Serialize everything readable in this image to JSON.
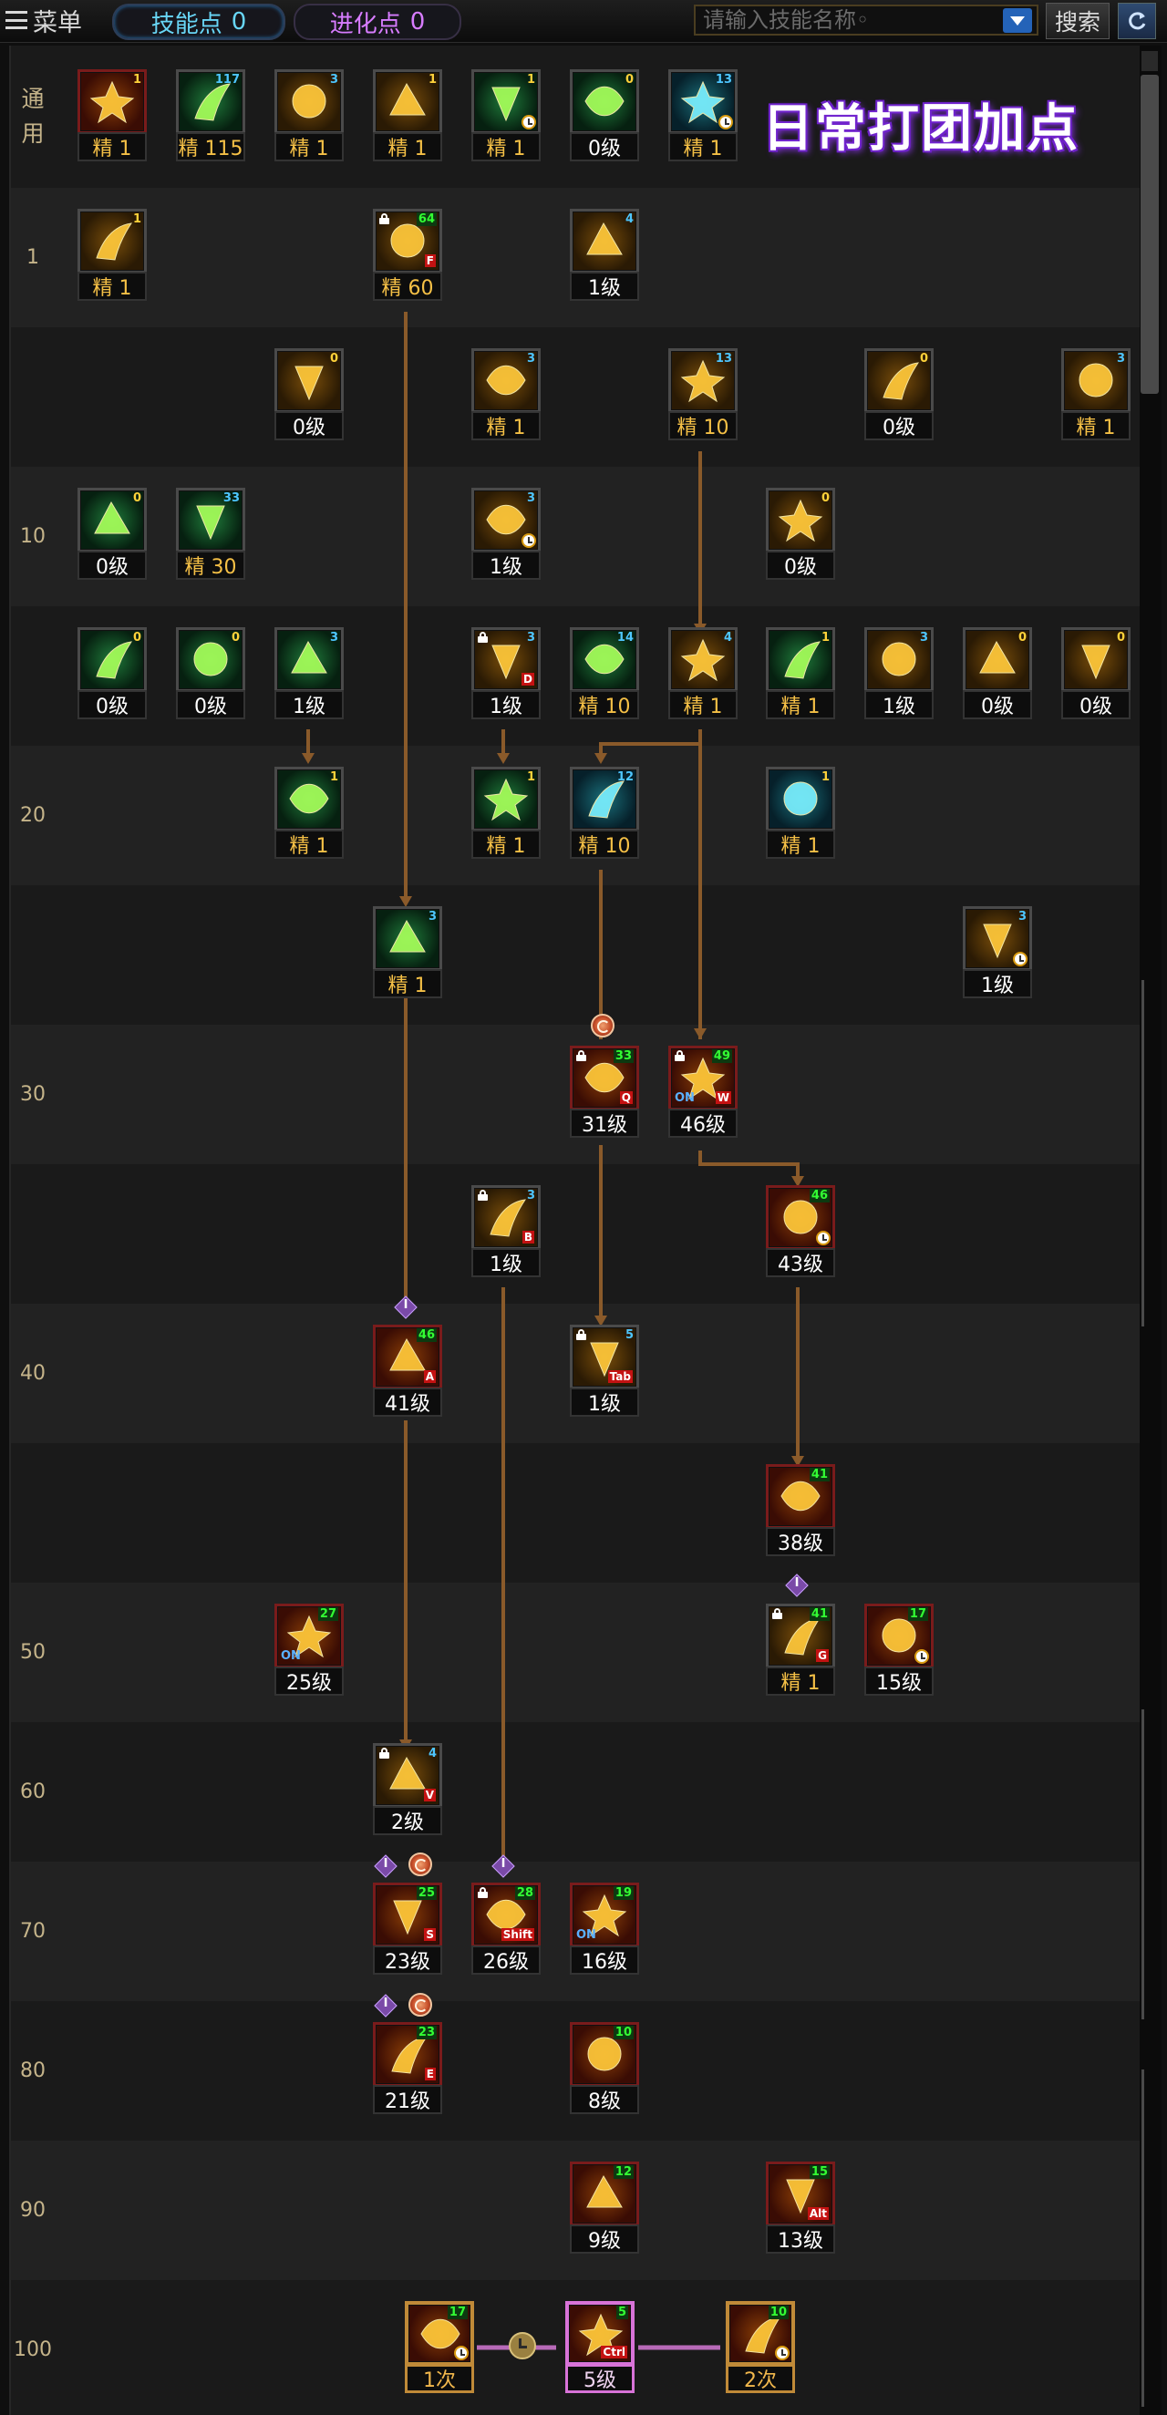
{
  "topbar": {
    "menu_label": "菜单",
    "skill_points_label": "技能点",
    "skill_points_value": "0",
    "evolution_points_label": "进化点",
    "evolution_points_value": "0",
    "search_placeholder": "请输入技能名称◦",
    "search_button": "搜索"
  },
  "overlay_title": "日常打团加点",
  "levels": {
    "common": [
      "通",
      "用"
    ],
    "rows": [
      "1",
      "10",
      "20",
      "30",
      "40",
      "50",
      "60",
      "70",
      "80",
      "90",
      "100"
    ]
  },
  "colors": {
    "line": "#8a5a2a",
    "chain": "#b86ab8",
    "skill_points_text": "#68d6f6",
    "evolution_points_text": "#d77cff",
    "jing_text": "#f5c046"
  },
  "skills": [
    {
      "id": "s1",
      "level": "精 1",
      "badge": "1",
      "badge_color": "yellow",
      "icon": "fire-blast-icon",
      "style": "red"
    },
    {
      "id": "s2",
      "level": "精 115",
      "badge": "117",
      "badge_color": "blue",
      "icon": "dragon-head-icon",
      "style": "green"
    },
    {
      "id": "s3",
      "level": "精 1",
      "badge": "3",
      "badge_color": "blue",
      "icon": "flame-dash-icon",
      "style": ""
    },
    {
      "id": "s4",
      "level": "精 1",
      "badge": "1",
      "badge_color": "yellow",
      "icon": "sitting-figure-icon",
      "style": ""
    },
    {
      "id": "s5",
      "level": "精 1",
      "badge": "1",
      "badge_color": "yellow",
      "icon": "running-figure-icon",
      "style": "green",
      "clock": true
    },
    {
      "id": "s6",
      "level": "0级",
      "badge": "0",
      "badge_color": "yellow",
      "icon": "target-icon",
      "style": "green"
    },
    {
      "id": "s7",
      "level": "精 1",
      "badge": "13",
      "badge_color": "blue",
      "icon": "wings-icon",
      "style": "teal",
      "clock": true
    },
    {
      "id": "s8",
      "level": "精 1",
      "badge": "1",
      "badge_color": "yellow",
      "icon": "fist-icon",
      "style": ""
    },
    {
      "id": "s9",
      "level": "精 60",
      "badge": "64",
      "badge_color": "green",
      "icon": "claw-slash-icon",
      "style": "",
      "lock": true,
      "hotkey": "F"
    },
    {
      "id": "s10",
      "level": "1级",
      "badge": "4",
      "badge_color": "blue",
      "icon": "claw-swipe-icon",
      "style": ""
    },
    {
      "id": "s11",
      "level": "0级",
      "badge": "0",
      "badge_color": "yellow",
      "icon": "feather-icon",
      "style": ""
    },
    {
      "id": "s12",
      "level": "精 1",
      "badge": "3",
      "badge_color": "blue",
      "icon": "arrow-burst-icon",
      "style": ""
    },
    {
      "id": "s13",
      "level": "精 10",
      "badge": "13",
      "badge_color": "blue",
      "icon": "crescent-icon",
      "style": ""
    },
    {
      "id": "s14",
      "level": "0级",
      "badge": "0",
      "badge_color": "yellow",
      "icon": "shield-icon",
      "style": ""
    },
    {
      "id": "s15",
      "level": "精 1",
      "badge": "3",
      "badge_color": "blue",
      "icon": "triple-claw-icon",
      "style": ""
    },
    {
      "id": "s16",
      "level": "0级",
      "badge": "0",
      "badge_color": "yellow",
      "icon": "green-spear-icon",
      "style": "green"
    },
    {
      "id": "s17",
      "level": "精 30",
      "badge": "33",
      "badge_color": "blue",
      "icon": "green-blade-icon",
      "style": "green"
    },
    {
      "id": "s18",
      "level": "1级",
      "badge": "3",
      "badge_color": "blue",
      "icon": "dash-figure-icon",
      "style": "",
      "clock": true
    },
    {
      "id": "s19",
      "level": "0级",
      "badge": "0",
      "badge_color": "yellow",
      "icon": "vortex-icon",
      "style": ""
    },
    {
      "id": "s20",
      "level": "0级",
      "badge": "0",
      "badge_color": "yellow",
      "icon": "green-slab-icon",
      "style": "green"
    },
    {
      "id": "s21",
      "level": "0级",
      "badge": "0",
      "badge_color": "yellow",
      "icon": "green-burst-icon",
      "style": "green"
    },
    {
      "id": "s22",
      "level": "1级",
      "badge": "3",
      "badge_color": "blue",
      "icon": "chain-icon",
      "style": "green"
    },
    {
      "id": "s23",
      "level": "1级",
      "badge": "3",
      "badge_color": "blue",
      "icon": "moon-slash-icon",
      "style": "",
      "lock": true,
      "hotkey": "D"
    },
    {
      "id": "s24",
      "level": "精 10",
      "badge": "14",
      "badge_color": "blue",
      "icon": "green-shield-icon",
      "style": "green"
    },
    {
      "id": "s25",
      "level": "精 1",
      "badge": "4",
      "badge_color": "blue",
      "icon": "sun-wheel-icon",
      "style": ""
    },
    {
      "id": "s26",
      "level": "精 1",
      "badge": "1",
      "badge_color": "yellow",
      "icon": "green-crescent-icon",
      "style": "green"
    },
    {
      "id": "s27",
      "level": "1级",
      "badge": "3",
      "badge_color": "blue",
      "icon": "twin-slash-icon",
      "style": ""
    },
    {
      "id": "s28",
      "level": "0级",
      "badge": "0",
      "badge_color": "yellow",
      "icon": "cross-sword-icon",
      "style": ""
    },
    {
      "id": "s29",
      "level": "0级",
      "badge": "0",
      "badge_color": "yellow",
      "icon": "spark-icon",
      "style": ""
    },
    {
      "id": "s30",
      "level": "精 1",
      "badge": "1",
      "badge_color": "yellow",
      "icon": "green-figure-icon",
      "style": "green"
    },
    {
      "id": "s31",
      "level": "精 1",
      "badge": "1",
      "badge_color": "yellow",
      "icon": "green-orb-icon",
      "style": "green"
    },
    {
      "id": "s32",
      "level": "精 10",
      "badge": "12",
      "badge_color": "blue",
      "icon": "pyramid-icon",
      "style": "teal"
    },
    {
      "id": "s33",
      "level": "精 1",
      "badge": "1",
      "badge_color": "yellow",
      "icon": "blue-spirit-icon",
      "style": "teal"
    },
    {
      "id": "s34",
      "level": "精 1",
      "badge": "3",
      "badge_color": "blue",
      "icon": "tornado-icon",
      "style": "green"
    },
    {
      "id": "s35",
      "level": "1级",
      "badge": "3",
      "badge_color": "blue",
      "icon": "fan-wind-icon",
      "style": "",
      "clock": true
    },
    {
      "id": "s36",
      "level": "31级",
      "badge": "33",
      "badge_color": "green",
      "icon": "flaming-slash-icon",
      "style": "red",
      "lock": true,
      "hotkey": "Q"
    },
    {
      "id": "s37",
      "level": "46级",
      "badge": "49",
      "badge_color": "green",
      "icon": "dragon-roar-icon",
      "style": "red",
      "lock": true,
      "hotkey": "W",
      "on": true
    },
    {
      "id": "s38",
      "level": "1级",
      "badge": "3",
      "badge_color": "blue",
      "icon": "pillar-icon",
      "style": "",
      "lock": true,
      "hotkey": "B"
    },
    {
      "id": "s39",
      "level": "43级",
      "badge": "46",
      "badge_color": "green",
      "icon": "fire-dragon-icon",
      "style": "red",
      "clock": true
    },
    {
      "id": "s40",
      "level": "41级",
      "badge": "46",
      "badge_color": "green",
      "icon": "fire-pierce-icon",
      "style": "red",
      "hotkey": "A"
    },
    {
      "id": "s41",
      "level": "1级",
      "badge": "5",
      "badge_color": "blue",
      "icon": "lance-icon",
      "style": "",
      "lock": true,
      "hotkey": "Tab"
    },
    {
      "id": "s42",
      "level": "38级",
      "badge": "41",
      "badge_color": "green",
      "icon": "fire-beast-icon",
      "style": "red"
    },
    {
      "id": "s43",
      "level": "25级",
      "badge": "27",
      "badge_color": "green",
      "icon": "green-aura-icon",
      "style": "red",
      "on": true
    },
    {
      "id": "s44",
      "level": "精 1",
      "badge": "41",
      "badge_color": "green",
      "icon": "golden-beast-icon",
      "style": "",
      "lock": true,
      "hotkey": "G"
    },
    {
      "id": "s45",
      "level": "15级",
      "badge": "17",
      "badge_color": "green",
      "icon": "fire-wolf-icon",
      "style": "red",
      "clock": true
    },
    {
      "id": "s46",
      "level": "2级",
      "badge": "4",
      "badge_color": "blue",
      "icon": "flame-pillar-icon",
      "style": "",
      "lock": true,
      "hotkey": "V"
    },
    {
      "id": "s47",
      "level": "23级",
      "badge": "25",
      "badge_color": "green",
      "icon": "fire-spiral-icon",
      "style": "red",
      "hotkey": "S"
    },
    {
      "id": "s48",
      "level": "26级",
      "badge": "28",
      "badge_color": "green",
      "icon": "fire-tower-icon",
      "style": "red",
      "lock": true,
      "hotkey": "Shift"
    },
    {
      "id": "s49",
      "level": "16级",
      "badge": "19",
      "badge_color": "green",
      "icon": "green-explosion-icon",
      "style": "red",
      "on": true
    },
    {
      "id": "s50",
      "level": "21级",
      "badge": "23",
      "badge_color": "green",
      "icon": "fire-crescent-icon",
      "style": "red",
      "hotkey": "E"
    },
    {
      "id": "s51",
      "level": "8级",
      "badge": "10",
      "badge_color": "green",
      "icon": "fire-storm-icon",
      "style": "red"
    },
    {
      "id": "s52",
      "level": "9级",
      "badge": "12",
      "badge_color": "green",
      "icon": "green-demon-icon",
      "style": "red"
    },
    {
      "id": "s53",
      "level": "13级",
      "badge": "15",
      "badge_color": "green",
      "icon": "fire-nova-icon",
      "style": "red",
      "hotkey": "Alt"
    },
    {
      "id": "s54",
      "level": "1次",
      "badge": "17",
      "badge_color": "green",
      "icon": "awakening-dragon-icon",
      "style": "red",
      "clock": true,
      "big": "gold"
    },
    {
      "id": "s55",
      "level": "5级",
      "badge": "5",
      "badge_color": "green",
      "icon": "awakening-burst-icon",
      "style": "red",
      "hotkey": "Ctrl",
      "big": "pink"
    },
    {
      "id": "s56",
      "level": "2次",
      "badge": "10",
      "badge_color": "green",
      "icon": "awakening-flame-icon",
      "style": "red",
      "clock": true,
      "big": "gold"
    }
  ]
}
